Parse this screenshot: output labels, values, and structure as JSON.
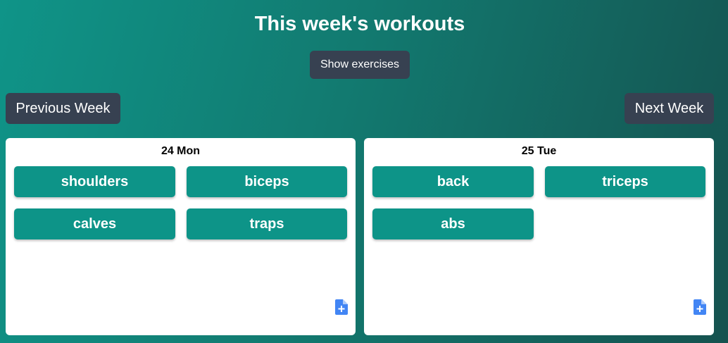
{
  "header": {
    "title": "This week's workouts",
    "show_exercises_label": "Show exercises"
  },
  "nav": {
    "previous_label": "Previous Week",
    "next_label": "Next Week"
  },
  "days": [
    {
      "label": "24 Mon",
      "exercises": [
        "shoulders",
        "biceps",
        "calves",
        "traps"
      ],
      "add_icon": "add-document-icon"
    },
    {
      "label": "25 Tue",
      "exercises": [
        "back",
        "triceps",
        "abs"
      ],
      "add_icon": "add-document-icon"
    }
  ],
  "colors": {
    "accent": "#0d9488",
    "button_dark": "#374151",
    "icon_blue": "#4285f4"
  }
}
